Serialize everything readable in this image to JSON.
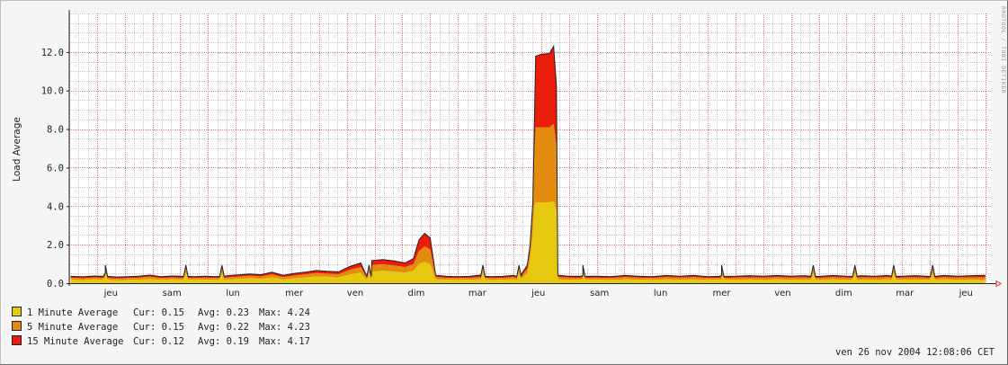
{
  "chart_data": {
    "type": "area",
    "title": "",
    "ylabel": "Load Average",
    "xlabel": "",
    "ylim": [
      0,
      14
    ],
    "y_ticks": [
      "0.0",
      "2.0",
      "4.0",
      "6.0",
      "8.0",
      "10.0",
      "12.0"
    ],
    "x_ticks": [
      "jeu",
      "sam",
      "lun",
      "mer",
      "ven",
      "dim",
      "mar",
      "jeu",
      "sam",
      "lun",
      "mer",
      "ven",
      "dim",
      "mar",
      "jeu"
    ],
    "grid": true,
    "stacked": true,
    "series": [
      {
        "name": "1 Minute Average",
        "color": "#e6c80e"
      },
      {
        "name": "5 Minute Average",
        "color": "#e38b0f"
      },
      {
        "name": "15 Minute Average",
        "color": "#ea1c0c"
      }
    ],
    "points": [
      [
        0.05,
        0.18,
        0.1,
        0.08
      ],
      [
        0.5,
        0.16,
        0.1,
        0.08
      ],
      [
        0.9,
        0.2,
        0.1,
        0.08
      ],
      [
        1.3,
        0.3,
        0.12,
        0.1
      ],
      [
        1.7,
        0.15,
        0.1,
        0.08
      ],
      [
        2.1,
        0.17,
        0.1,
        0.08
      ],
      [
        2.5,
        0.18,
        0.11,
        0.08
      ],
      [
        2.9,
        0.22,
        0.12,
        0.09
      ],
      [
        3.3,
        0.17,
        0.1,
        0.08
      ],
      [
        3.7,
        0.2,
        0.1,
        0.08
      ],
      [
        4.1,
        0.18,
        0.1,
        0.08
      ],
      [
        4.5,
        0.17,
        0.1,
        0.08
      ],
      [
        4.9,
        0.18,
        0.11,
        0.08
      ],
      [
        5.3,
        0.17,
        0.1,
        0.08
      ],
      [
        5.7,
        0.2,
        0.11,
        0.09
      ],
      [
        6.1,
        0.22,
        0.12,
        0.1
      ],
      [
        6.5,
        0.25,
        0.14,
        0.1
      ],
      [
        6.9,
        0.22,
        0.13,
        0.1
      ],
      [
        7.3,
        0.3,
        0.16,
        0.12
      ],
      [
        7.7,
        0.2,
        0.12,
        0.1
      ],
      [
        8.1,
        0.25,
        0.15,
        0.12
      ],
      [
        8.5,
        0.3,
        0.16,
        0.12
      ],
      [
        8.9,
        0.35,
        0.18,
        0.14
      ],
      [
        9.3,
        0.33,
        0.17,
        0.13
      ],
      [
        9.7,
        0.3,
        0.17,
        0.13
      ],
      [
        10.1,
        0.45,
        0.25,
        0.18
      ],
      [
        10.5,
        0.55,
        0.3,
        0.22
      ],
      [
        10.9,
        0.6,
        0.35,
        0.25
      ],
      [
        11.3,
        0.65,
        0.35,
        0.25
      ],
      [
        11.7,
        0.6,
        0.33,
        0.25
      ],
      [
        12.1,
        0.55,
        0.3,
        0.22
      ],
      [
        12.4,
        0.65,
        0.35,
        0.3
      ],
      [
        12.6,
        1.0,
        0.7,
        0.6
      ],
      [
        12.8,
        1.1,
        0.85,
        0.7
      ],
      [
        13.0,
        1.0,
        0.8,
        0.6
      ],
      [
        13.2,
        0.2,
        0.12,
        0.1
      ],
      [
        13.6,
        0.18,
        0.1,
        0.08
      ],
      [
        14.0,
        0.17,
        0.1,
        0.08
      ],
      [
        14.4,
        0.18,
        0.1,
        0.08
      ],
      [
        14.8,
        0.2,
        0.12,
        0.1
      ],
      [
        15.2,
        0.17,
        0.1,
        0.08
      ],
      [
        15.6,
        0.18,
        0.1,
        0.08
      ],
      [
        16.0,
        0.2,
        0.12,
        0.09
      ],
      [
        16.3,
        0.25,
        0.15,
        0.1
      ],
      [
        16.5,
        0.5,
        0.25,
        0.2
      ],
      [
        16.6,
        1.2,
        0.5,
        0.3
      ],
      [
        16.7,
        2.5,
        1.2,
        0.6
      ],
      [
        16.75,
        4.0,
        2.5,
        1.5
      ],
      [
        16.8,
        4.2,
        4.1,
        3.8
      ],
      [
        17.0,
        4.2,
        4.1,
        3.9
      ],
      [
        17.3,
        4.2,
        4.1,
        3.95
      ],
      [
        17.45,
        4.24,
        4.23,
        4.17
      ],
      [
        17.55,
        3.8,
        3.5,
        3.2
      ],
      [
        17.6,
        0.2,
        0.12,
        0.1
      ],
      [
        18.0,
        0.18,
        0.11,
        0.08
      ],
      [
        18.5,
        0.2,
        0.12,
        0.09
      ],
      [
        19.0,
        0.18,
        0.11,
        0.08
      ],
      [
        19.5,
        0.17,
        0.1,
        0.08
      ],
      [
        20.0,
        0.2,
        0.12,
        0.09
      ],
      [
        20.5,
        0.18,
        0.11,
        0.08
      ],
      [
        21.0,
        0.17,
        0.1,
        0.08
      ],
      [
        21.5,
        0.2,
        0.12,
        0.09
      ],
      [
        22.0,
        0.18,
        0.11,
        0.08
      ],
      [
        22.5,
        0.2,
        0.12,
        0.09
      ],
      [
        23.0,
        0.17,
        0.1,
        0.08
      ],
      [
        23.5,
        0.2,
        0.12,
        0.09
      ],
      [
        24.0,
        0.18,
        0.11,
        0.08
      ],
      [
        24.5,
        0.19,
        0.12,
        0.09
      ],
      [
        25.0,
        0.18,
        0.11,
        0.08
      ],
      [
        25.5,
        0.2,
        0.12,
        0.09
      ],
      [
        26.0,
        0.18,
        0.11,
        0.08
      ],
      [
        26.5,
        0.19,
        0.12,
        0.09
      ],
      [
        27.0,
        0.17,
        0.11,
        0.08
      ],
      [
        27.5,
        0.2,
        0.12,
        0.09
      ],
      [
        28.0,
        0.18,
        0.11,
        0.08
      ],
      [
        28.5,
        0.19,
        0.12,
        0.09
      ],
      [
        29.0,
        0.18,
        0.11,
        0.08
      ],
      [
        29.5,
        0.2,
        0.12,
        0.09
      ],
      [
        30.0,
        0.18,
        0.11,
        0.08
      ],
      [
        30.5,
        0.19,
        0.12,
        0.09
      ],
      [
        31.0,
        0.17,
        0.11,
        0.08
      ],
      [
        31.5,
        0.2,
        0.12,
        0.09
      ],
      [
        32.0,
        0.18,
        0.11,
        0.08
      ],
      [
        32.5,
        0.19,
        0.12,
        0.09
      ],
      [
        33.0,
        0.15,
        0.15,
        0.12
      ]
    ],
    "spikes": [
      1.3,
      4.2,
      5.5,
      10.8,
      14.9,
      16.2,
      18.5,
      23.5,
      26.8,
      28.3,
      29.7,
      31.1
    ]
  },
  "legend": [
    {
      "label": "1 Minute Average",
      "cur": "Cur: 0.15",
      "avg": "Avg: 0.23",
      "max": "Max: 4.24",
      "color": "#e6c80e"
    },
    {
      "label": "5 Minute Average",
      "cur": "Cur: 0.15",
      "avg": "Avg: 0.22",
      "max": "Max: 4.23",
      "color": "#e38b0f"
    },
    {
      "label": "15 Minute Average",
      "cur": "Cur: 0.12",
      "avg": "Avg: 0.19",
      "max": "Max: 4.17",
      "color": "#ea1c0c"
    }
  ],
  "footer": "ven 26 nov 2004 12:08:06 CET",
  "watermark": "RRDTOOL / TOBI OETIKER"
}
